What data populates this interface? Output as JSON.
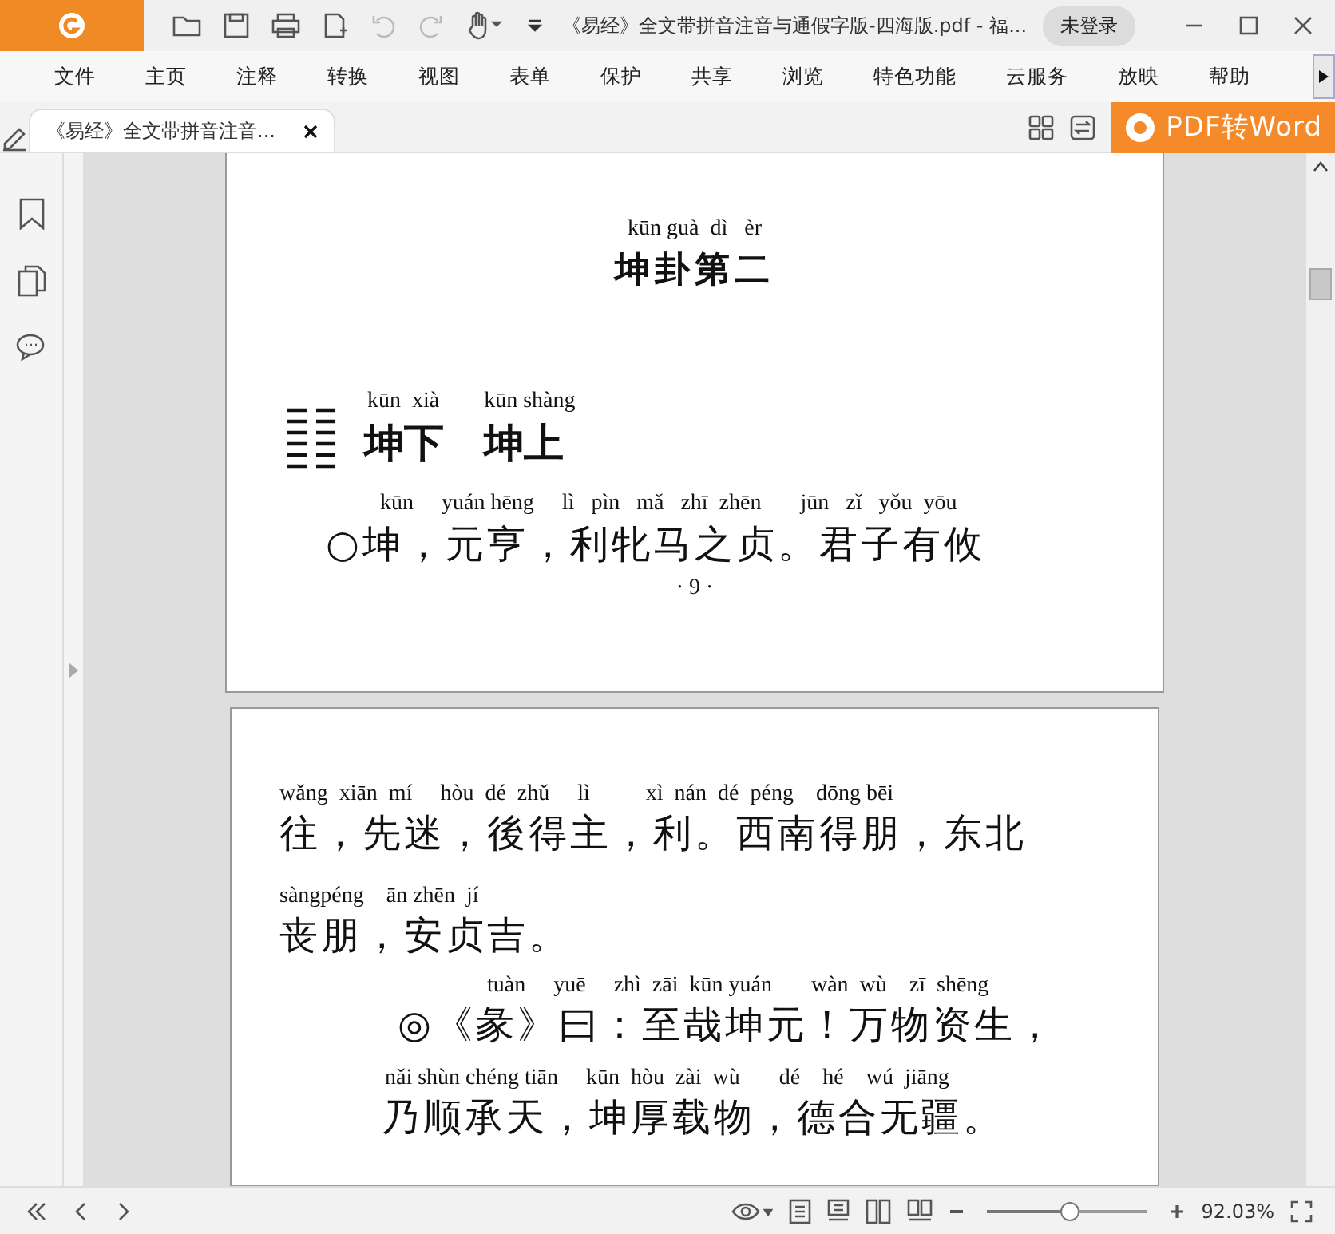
{
  "title_bar": {
    "title": "《易经》全文带拼音注音与通假字版-四海版.pdf - 福...",
    "login_button": "未登录"
  },
  "menu": [
    "文件",
    "主页",
    "注释",
    "转换",
    "视图",
    "表单",
    "保护",
    "共享",
    "浏览",
    "特色功能",
    "云服务",
    "放映",
    "帮助"
  ],
  "tabs": [
    {
      "label": "《易经》全文带拼音注音...",
      "selected": true
    }
  ],
  "convert_button": "PDF转Word",
  "pages": [
    {
      "lines": [
        {
          "kind": "title-pinyin",
          "text": "kūn guà  dì   èr"
        },
        {
          "kind": "title",
          "text": "坤卦第二"
        },
        {
          "kind": "pinyin",
          "text": "kūn  xià        kūn shàng"
        },
        {
          "kind": "heading",
          "text": "坤下　坤上"
        },
        {
          "kind": "pinyin",
          "text": "kūn     yuán hēng     lì   pìn   mǎ   zhī  zhēn       jūn   zǐ   yǒu  yōu"
        },
        {
          "kind": "text",
          "text": "○坤，元亨，利牝马之贞。君子有攸"
        },
        {
          "kind": "page-number",
          "text": "· 9 ·"
        }
      ]
    },
    {
      "lines": [
        {
          "kind": "pinyin",
          "text": "wǎng  xiān  mí     hòu  dé  zhǔ     lì          xì  nán  dé  péng    dōng bēi"
        },
        {
          "kind": "text",
          "text": "往，先迷，後得主，利。西南得朋，东北"
        },
        {
          "kind": "pinyin",
          "text": "sàngpéng    ān zhēn  jí"
        },
        {
          "kind": "text",
          "text": "丧朋，安贞吉。"
        },
        {
          "kind": "pinyin",
          "text": "tuàn     yuē     zhì  zāi  kūn yuán       wàn  wù    zī  shēng"
        },
        {
          "kind": "text",
          "text": "◎《彖》曰：至哉坤元！万物资生，"
        },
        {
          "kind": "pinyin",
          "text": "nǎi shùn chéng tiān     kūn  hòu  zài  wù       dé    hé    wú  jiāng"
        },
        {
          "kind": "text",
          "text": "乃顺承天，坤厚载物，德合无疆。"
        }
      ]
    }
  ],
  "status_bar": {
    "zoom": {
      "level": 0.52,
      "reading": "92.03%"
    }
  }
}
